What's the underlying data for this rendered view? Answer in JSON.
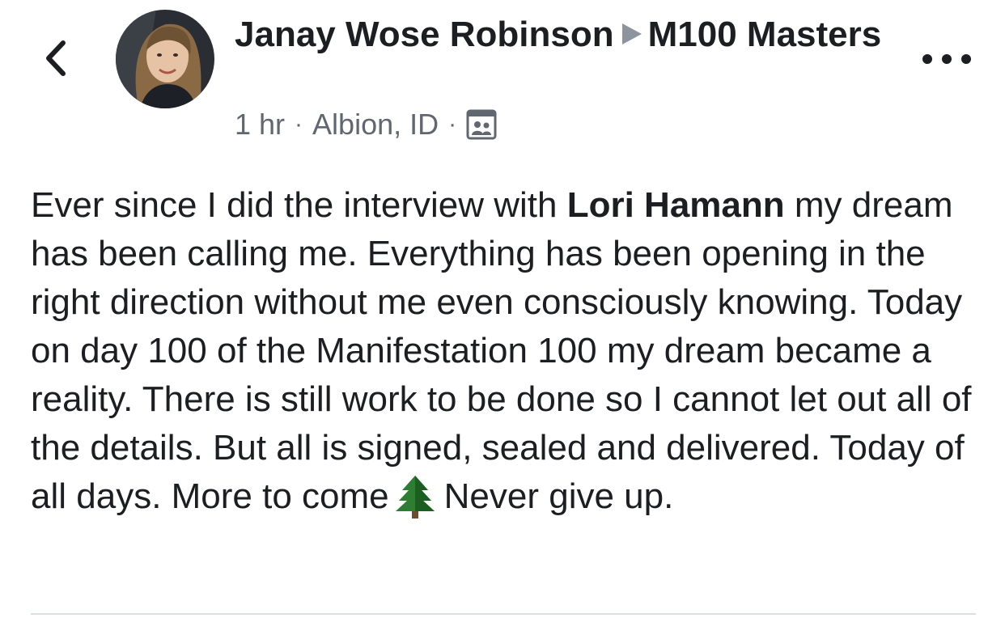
{
  "header": {
    "author_name": "Janay Wose Robinson",
    "group_name": "M100 Masters",
    "time": "1 hr",
    "location": "Albion, ID",
    "separator": "·",
    "audience_icon": "group-audience-icon",
    "back_icon": "chevron-left-icon",
    "more_icon": "more-options-icon"
  },
  "post": {
    "text_before_mention": "Ever since I did the interview with ",
    "mention": "Lori Hamann",
    "text_after_mention": " my dream has been calling me. Everything has been opening in the right direction without me even consciously knowing. Today on day 100 of the Manifestation 100 my dream became a reality. There is still work to be done so I cannot let out all of the details. But all is signed, sealed and delivered. Today of all days. More to come",
    "emoji_icon": "evergreen-tree-icon",
    "text_end": "Never give up."
  },
  "colors": {
    "text": "#1c1e21",
    "meta": "#606770",
    "arrow": "#8d949e",
    "divider": "#dadde1",
    "tree": "#2e7d32"
  }
}
